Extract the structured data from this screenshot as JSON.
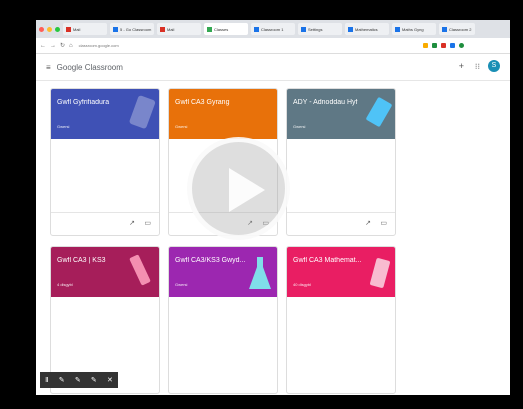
{
  "browser": {
    "tabs": [
      {
        "label": "Mail",
        "color": "#d93025"
      },
      {
        "label": "5 - Go Classroom",
        "color": "#1a73e8"
      },
      {
        "label": "Mail",
        "color": "#d93025"
      },
      {
        "label": "Classes",
        "color": "#34a853",
        "active": true
      },
      {
        "label": "Classroom 1",
        "color": "#1a73e8"
      },
      {
        "label": "Settings",
        "color": "#1a73e8"
      },
      {
        "label": "Mathematics",
        "color": "#1a73e8"
      },
      {
        "label": "Maths Gyng",
        "color": "#1a73e8"
      },
      {
        "label": "Classroom 2",
        "color": "#1a73e8"
      }
    ],
    "url": "classroom.google.com"
  },
  "app": {
    "logo": "Google Classroom",
    "plus": "+",
    "avatar": "S"
  },
  "cards": [
    {
      "title": "Gwfl Gyfrifiadura",
      "sub": "Gwersi",
      "color": "#3f51b5"
    },
    {
      "title": "Gwfl CA3 Gyrang",
      "sub": "Gwersi",
      "color": "#e8710a"
    },
    {
      "title": "ADY - Adnoddau Hyf",
      "sub": "Gwersi",
      "color": "#5f7885"
    },
    {
      "title": "Gwfl CA3 | KS3",
      "sub": "4 disgybl",
      "color": "#a61e5a"
    },
    {
      "title": "Gwfl CA3/KS3 Gwyd...",
      "sub": "Gwersi",
      "color": "#9c27b0"
    },
    {
      "title": "Gwfl CA3 Mathemat...",
      "sub": "40 disgybl",
      "color": "#e91e63"
    }
  ],
  "icons": {
    "trend": "↗",
    "folder": "▭",
    "menu": "≡",
    "apps": "⁝⁝"
  },
  "annotation_tools": [
    "Ⅱ",
    "✎",
    "✎",
    "✎",
    "✕"
  ]
}
